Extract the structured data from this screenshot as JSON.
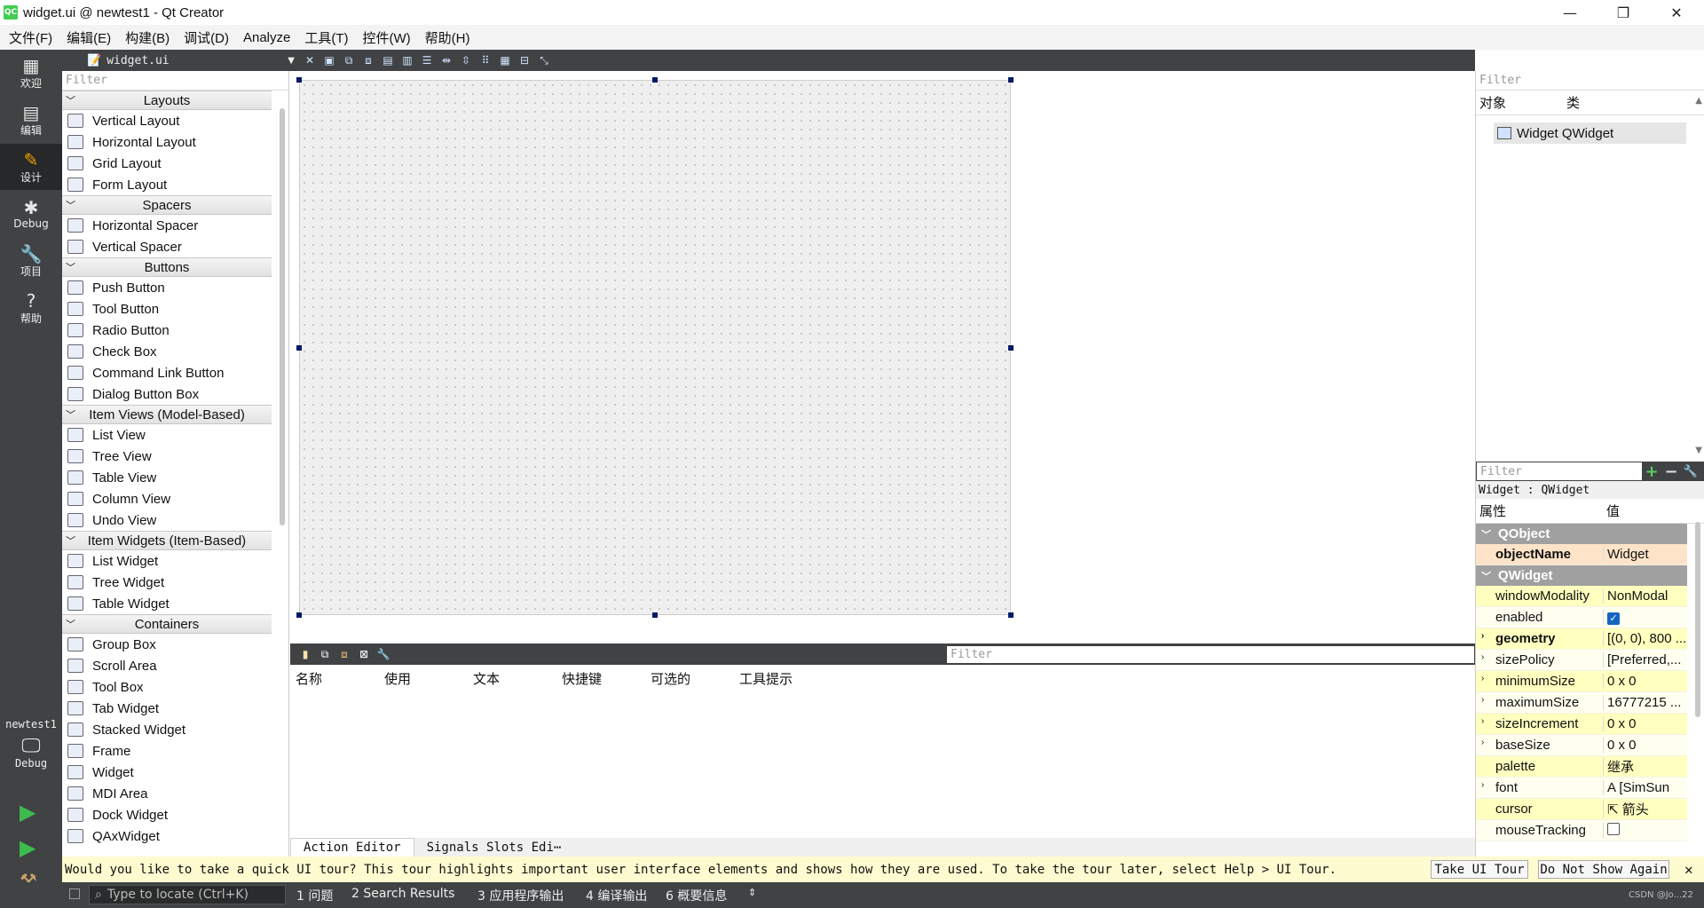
{
  "window": {
    "title": "widget.ui @ newtest1 - Qt Creator",
    "app_icon_text": "QC",
    "controls": [
      "—",
      "❐",
      "✕"
    ]
  },
  "menu": [
    "文件(F)",
    "编辑(E)",
    "构建(B)",
    "调试(D)",
    "Analyze",
    "工具(T)",
    "控件(W)",
    "帮助(H)"
  ],
  "modes": [
    {
      "label": "欢迎",
      "icon": "grid-icon"
    },
    {
      "label": "编辑",
      "icon": "document-icon"
    },
    {
      "label": "设计",
      "icon": "pencil-icon"
    },
    {
      "label": "Debug",
      "icon": "bug-icon"
    },
    {
      "label": "项目",
      "icon": "wrench-icon"
    },
    {
      "label": "帮助",
      "icon": "help-icon"
    }
  ],
  "kit": {
    "project": "newtest1",
    "config": "Debug"
  },
  "editor": {
    "file_name": "widget.ui"
  },
  "widget_box": {
    "filter_placeholder": "Filter",
    "categories": [
      {
        "name": "Layouts",
        "items": [
          "Vertical Layout",
          "Horizontal Layout",
          "Grid Layout",
          "Form Layout"
        ]
      },
      {
        "name": "Spacers",
        "items": [
          "Horizontal Spacer",
          "Vertical Spacer"
        ]
      },
      {
        "name": "Buttons",
        "items": [
          "Push Button",
          "Tool Button",
          "Radio Button",
          "Check Box",
          "Command Link Button",
          "Dialog Button Box"
        ]
      },
      {
        "name": "Item Views (Model-Based)",
        "items": [
          "List View",
          "Tree View",
          "Table View",
          "Column View",
          "Undo View"
        ]
      },
      {
        "name": "Item Widgets (Item-Based)",
        "items": [
          "List Widget",
          "Tree Widget",
          "Table Widget"
        ]
      },
      {
        "name": "Containers",
        "items": [
          "Group Box",
          "Scroll Area",
          "Tool Box",
          "Tab Widget",
          "Stacked Widget",
          "Frame",
          "Widget",
          "MDI Area",
          "Dock Widget",
          "QAxWidget"
        ]
      }
    ]
  },
  "action_editor": {
    "filter_placeholder": "Filter",
    "columns": [
      "名称",
      "使用",
      "文本",
      "快捷键",
      "可选的",
      "工具提示"
    ],
    "tabs": [
      "Action Editor",
      "Signals Slots Edi⋯"
    ]
  },
  "object_inspector": {
    "filter_placeholder": "Filter",
    "columns": [
      "对象",
      "类"
    ],
    "row": "Widget QWidget"
  },
  "property_editor": {
    "filter_placeholder": "Filter",
    "caption": "Widget : QWidget",
    "columns": [
      "属性",
      "值"
    ],
    "groups": [
      {
        "name": "QObject",
        "rows": [
          {
            "name": "objectName",
            "value": "Widget",
            "bold": true
          }
        ]
      },
      {
        "name": "QWidget",
        "rows": [
          {
            "name": "windowModality",
            "value": "NonModal"
          },
          {
            "name": "enabled",
            "value": ""
          },
          {
            "name": "geometry",
            "value": "[(0, 0), 800 ...",
            "bold": true
          },
          {
            "name": "sizePolicy",
            "value": "[Preferred,..."
          },
          {
            "name": "minimumSize",
            "value": "0 x 0"
          },
          {
            "name": "maximumSize",
            "value": "16777215 ..."
          },
          {
            "name": "sizeIncrement",
            "value": "0 x 0"
          },
          {
            "name": "baseSize",
            "value": "0 x 0"
          },
          {
            "name": "palette",
            "value": "继承"
          },
          {
            "name": "font",
            "value": "A  [SimSun"
          },
          {
            "name": "cursor",
            "value": "箭头"
          },
          {
            "name": "mouseTracking",
            "value": ""
          }
        ]
      }
    ]
  },
  "tour": {
    "text": "Would you like to take a quick UI tour? This tour highlights important user interface elements and shows how they are used. To take the tour later, select Help > UI Tour.",
    "take_label": "Take UI Tour",
    "dismiss_label": "Do Not Show Again"
  },
  "status": {
    "locator_placeholder": "Type to locate (Ctrl+K)",
    "panes": [
      "1 问题",
      "2 Search Results",
      "3 应用程序输出",
      "4 编译输出",
      "6 概要信息"
    ],
    "watermark": "CSDN @Jo...22"
  }
}
